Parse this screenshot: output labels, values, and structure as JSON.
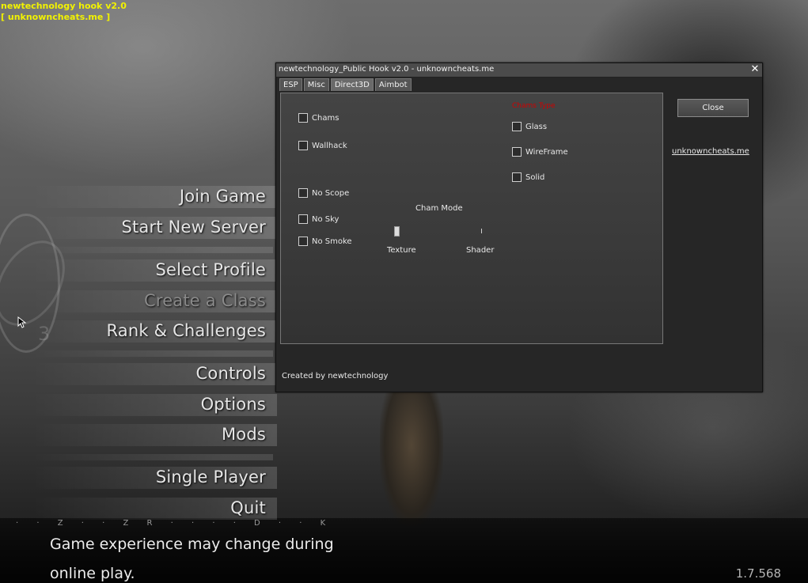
{
  "overlay": {
    "line1": "newtechnology hook v2.0",
    "line2": "[ unknowncheats.me ]"
  },
  "main_menu": {
    "items": [
      {
        "label": "Join Game",
        "disabled": false
      },
      {
        "label": "Start New Server",
        "disabled": false
      },
      {
        "label": "Select Profile",
        "disabled": false
      },
      {
        "label": "Create a Class",
        "disabled": true
      },
      {
        "label": "Rank & Challenges",
        "disabled": false
      },
      {
        "label": "Controls",
        "disabled": false
      },
      {
        "label": "Options",
        "disabled": false
      },
      {
        "label": "Mods",
        "disabled": false
      },
      {
        "label": "Single Player",
        "disabled": false
      },
      {
        "label": "Quit",
        "disabled": false
      }
    ],
    "emblem_number": "3"
  },
  "footer": {
    "hud_strip": "· · Z · · Z R · · · · D · · K",
    "notice_line1": "Game experience may change during",
    "notice_line2": "online play.",
    "version": "1.7.568"
  },
  "hack_window": {
    "title": "newtechnology_Public Hook v2.0 - unknowncheats.me",
    "close_glyph": "✕",
    "tabs": [
      {
        "label": "ESP",
        "active": false
      },
      {
        "label": "Misc",
        "active": false
      },
      {
        "label": "Direct3D",
        "active": true
      },
      {
        "label": "Aimbot",
        "active": false
      }
    ],
    "left_options": [
      {
        "label": "Chams",
        "checked": false
      },
      {
        "label": "Wallhack",
        "checked": false
      },
      {
        "label": "No Scope",
        "checked": false
      },
      {
        "label": "No Sky",
        "checked": false
      },
      {
        "label": "No Smoke",
        "checked": false
      }
    ],
    "chams_type": {
      "heading": "Chams Type",
      "options": [
        {
          "label": "Glass",
          "checked": false
        },
        {
          "label": "WireFrame",
          "checked": false
        },
        {
          "label": "Solid",
          "checked": false
        }
      ]
    },
    "cham_mode": {
      "label": "Cham Mode",
      "min_label": "Texture",
      "max_label": "Shader",
      "value": 0
    },
    "close_button": "Close",
    "site_link": "unknowncheats.me",
    "credit": "Created by newtechnology"
  },
  "colors": {
    "overlay_text": "#f2f200",
    "chams_heading": "#d00000"
  }
}
